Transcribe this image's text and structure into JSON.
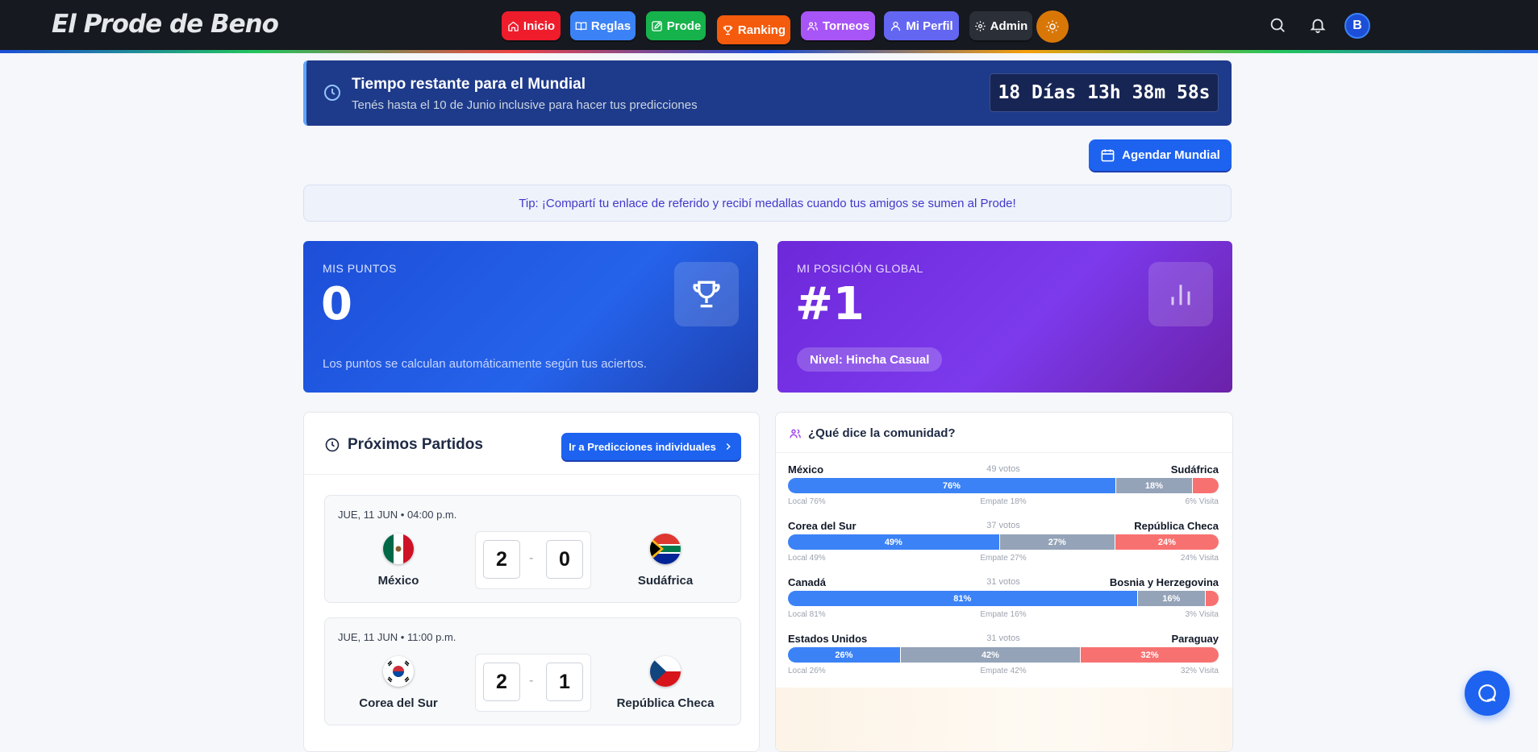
{
  "brand": "El Prode de Beno",
  "nav": [
    {
      "label": "Inicio",
      "icon": "home-icon",
      "color": "#ef1c2c"
    },
    {
      "label": "Reglas",
      "icon": "book-icon",
      "color": "#3b82f6"
    },
    {
      "label": "Prode",
      "icon": "edit-icon",
      "color": "#16b24b"
    },
    {
      "label": "Ranking",
      "icon": "trophy-icon",
      "color": "#f45b0c"
    },
    {
      "label": "Torneos",
      "icon": "users-icon",
      "color": "#a855f7"
    },
    {
      "label": "Mi Perfil",
      "icon": "user-icon",
      "color": "#6366f1"
    },
    {
      "label": "Admin",
      "icon": "gear-icon",
      "color": "#2a2f38"
    }
  ],
  "user": {
    "avatar_initial": "B"
  },
  "countdown": {
    "title": "Tiempo restante para el Mundial",
    "subtitle": "Tenés hasta el 10 de Junio inclusive para hacer tus predicciones",
    "timer": "18 Días 13h 38m 58s"
  },
  "agendar_label": "Agendar Mundial",
  "tip": "Tip: ¡Compartí tu enlace de referido y recibí medallas cuando tus amigos se sumen al Prode!",
  "points": {
    "label": "MIS PUNTOS",
    "value": "0",
    "note": "Los puntos se calculan automáticamente según tus aciertos."
  },
  "position": {
    "label": "MI POSICIÓN GLOBAL",
    "value": "#1",
    "level": "Nivel: Hincha Casual"
  },
  "matches": {
    "title": "Próximos Partidos",
    "button": "Ir a Predicciones individuales",
    "items": [
      {
        "date": "JUE, 11 JUN • 04:00 p.m.",
        "home": "México",
        "away": "Sudáfrica",
        "home_score": "2",
        "away_score": "0"
      },
      {
        "date": "JUE, 11 JUN • 11:00 p.m.",
        "home": "Corea del Sur",
        "away": "República Checa",
        "home_score": "2",
        "away_score": "1"
      }
    ]
  },
  "community": {
    "title": "¿Qué dice la comunidad?",
    "items": [
      {
        "home": "México",
        "away": "Sudáfrica",
        "votes": "49 votos",
        "local": 76,
        "draw": 18,
        "visit": 6,
        "local_label": "76%",
        "draw_label": "18%",
        "visit_label": "",
        "legend_local": "Local 76%",
        "legend_draw": "Empate 18%",
        "legend_visit": "6% Visita"
      },
      {
        "home": "Corea del Sur",
        "away": "República Checa",
        "votes": "37 votos",
        "local": 49,
        "draw": 27,
        "visit": 24,
        "local_label": "49%",
        "draw_label": "27%",
        "visit_label": "24%",
        "legend_local": "Local 49%",
        "legend_draw": "Empate 27%",
        "legend_visit": "24% Visita"
      },
      {
        "home": "Canadá",
        "away": "Bosnia y Herzegovina",
        "votes": "31 votos",
        "local": 81,
        "draw": 16,
        "visit": 3,
        "local_label": "81%",
        "draw_label": "16%",
        "visit_label": "",
        "legend_local": "Local 81%",
        "legend_draw": "Empate 16%",
        "legend_visit": "3% Visita"
      },
      {
        "home": "Estados Unidos",
        "away": "Paraguay",
        "votes": "31 votos",
        "local": 26,
        "draw": 42,
        "visit": 32,
        "local_label": "26%",
        "draw_label": "42%",
        "visit_label": "32%",
        "legend_local": "Local 26%",
        "legend_draw": "Empate 42%",
        "legend_visit": "32% Visita"
      }
    ]
  }
}
